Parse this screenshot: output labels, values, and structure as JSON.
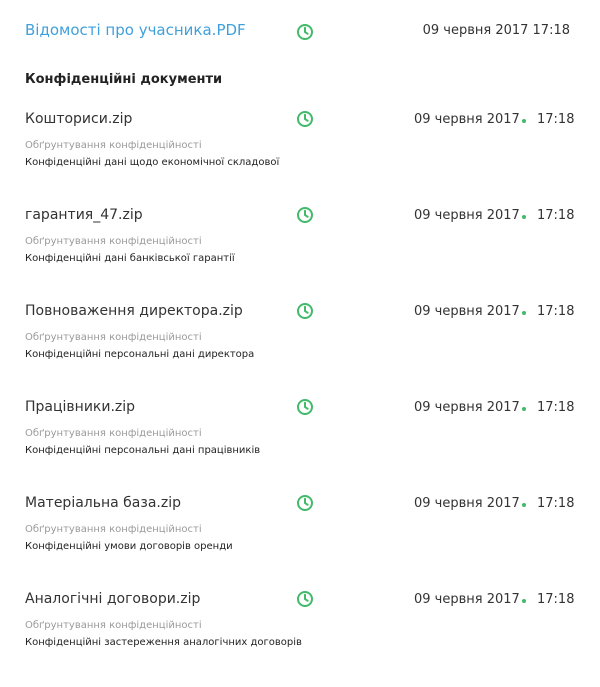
{
  "top_file": {
    "name": "Відомості про учасника.PDF",
    "datetime": "09 червня 2017 17:18",
    "icon": "clock-icon",
    "link_color": "#3fa0dc"
  },
  "section": {
    "title": "Конфіденційні документи"
  },
  "documents": [
    {
      "name": "Кошториси.zip",
      "date": "09 червня 2017",
      "time": "17:18",
      "reason_label": "Обґрунтування конфіденційності",
      "reason": "Конфіденційні дані щодо економічної складової"
    },
    {
      "name": "гарантия_47.zip",
      "date": "09 червня 2017",
      "time": "17:18",
      "reason_label": "Обґрунтування конфіденційності",
      "reason": "Конфіденційні дані банківської гарантії"
    },
    {
      "name": "Повноваження директора.zip",
      "date": "09 червня 2017",
      "time": "17:18",
      "reason_label": "Обґрунтування конфіденційності",
      "reason": "Конфіденційні персональні дані директора"
    },
    {
      "name": "Працівники.zip",
      "date": "09 червня 2017",
      "time": "17:18",
      "reason_label": "Обґрунтування конфіденційності",
      "reason": "Конфіденційні персональні дані працівників"
    },
    {
      "name": "Матеріальна база.zip",
      "date": "09 червня 2017",
      "time": "17:18",
      "reason_label": "Обґрунтування конфіденційності",
      "reason": "Конфіденційні умови договорів оренди"
    },
    {
      "name": "Аналогічні договори.zip",
      "date": "09 червня 2017",
      "time": "17:18",
      "reason_label": "Обґрунтування конфіденційності",
      "reason": "Конфіденційні застереження аналогічних договорів"
    }
  ],
  "colors": {
    "accent_green": "#43b96a",
    "link_blue": "#3fa0dc"
  }
}
